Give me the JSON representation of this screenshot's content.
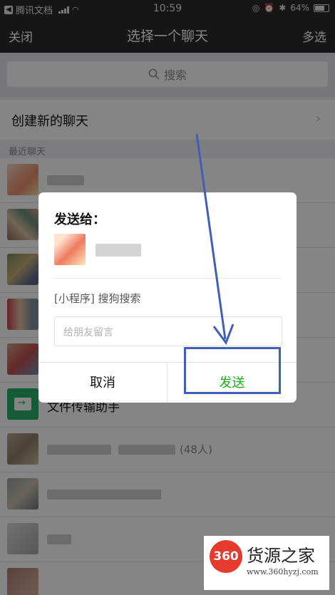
{
  "status_bar": {
    "carrier": "腾讯文档",
    "time": "10:59",
    "battery": "64%"
  },
  "nav": {
    "close": "关闭",
    "title": "选择一个聊天",
    "multi_select": "多选"
  },
  "search": {
    "label": "搜索"
  },
  "new_chat": {
    "label": "创建新的聊天",
    "chevron": "›"
  },
  "section": {
    "recent": "最近聊天"
  },
  "chats": [
    {
      "name": ""
    },
    {
      "name": ""
    },
    {
      "name": ""
    },
    {
      "name": ""
    },
    {
      "name": ""
    },
    {
      "name": "文件传输助手"
    },
    {
      "name": "",
      "count": "(48人)"
    },
    {
      "name": ""
    },
    {
      "name": ""
    },
    {
      "name": ""
    }
  ],
  "dialog": {
    "title": "发送给：",
    "mini_program": "[小程序] 搜狗搜索",
    "message_placeholder": "给朋友留言",
    "cancel": "取消",
    "send": "发送"
  },
  "watermark": {
    "logo": "360",
    "text": "货源之家",
    "url": "www.360hyzj.com"
  },
  "colors": {
    "navbar": "#2b2b2b",
    "send_green": "#1aad19",
    "annotation_blue": "#3f5fb8",
    "file_helper_green": "#2aae67",
    "watermark_red": "#e63a2e"
  }
}
